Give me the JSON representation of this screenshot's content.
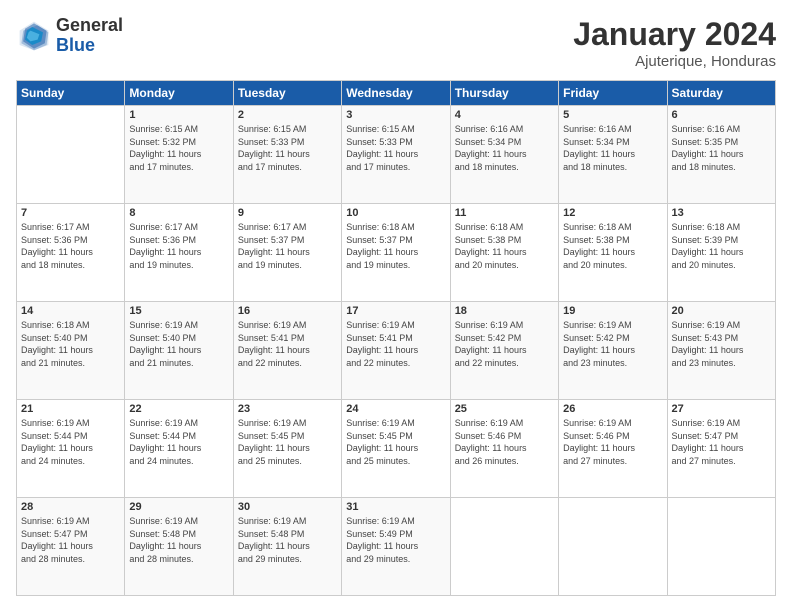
{
  "logo": {
    "general": "General",
    "blue": "Blue"
  },
  "header": {
    "month": "January 2024",
    "location": "Ajuterique, Honduras"
  },
  "days_of_week": [
    "Sunday",
    "Monday",
    "Tuesday",
    "Wednesday",
    "Thursday",
    "Friday",
    "Saturday"
  ],
  "weeks": [
    [
      {
        "day": "",
        "info": ""
      },
      {
        "day": "1",
        "info": "Sunrise: 6:15 AM\nSunset: 5:32 PM\nDaylight: 11 hours\nand 17 minutes."
      },
      {
        "day": "2",
        "info": "Sunrise: 6:15 AM\nSunset: 5:33 PM\nDaylight: 11 hours\nand 17 minutes."
      },
      {
        "day": "3",
        "info": "Sunrise: 6:15 AM\nSunset: 5:33 PM\nDaylight: 11 hours\nand 17 minutes."
      },
      {
        "day": "4",
        "info": "Sunrise: 6:16 AM\nSunset: 5:34 PM\nDaylight: 11 hours\nand 18 minutes."
      },
      {
        "day": "5",
        "info": "Sunrise: 6:16 AM\nSunset: 5:34 PM\nDaylight: 11 hours\nand 18 minutes."
      },
      {
        "day": "6",
        "info": "Sunrise: 6:16 AM\nSunset: 5:35 PM\nDaylight: 11 hours\nand 18 minutes."
      }
    ],
    [
      {
        "day": "7",
        "info": "Sunrise: 6:17 AM\nSunset: 5:36 PM\nDaylight: 11 hours\nand 18 minutes."
      },
      {
        "day": "8",
        "info": "Sunrise: 6:17 AM\nSunset: 5:36 PM\nDaylight: 11 hours\nand 19 minutes."
      },
      {
        "day": "9",
        "info": "Sunrise: 6:17 AM\nSunset: 5:37 PM\nDaylight: 11 hours\nand 19 minutes."
      },
      {
        "day": "10",
        "info": "Sunrise: 6:18 AM\nSunset: 5:37 PM\nDaylight: 11 hours\nand 19 minutes."
      },
      {
        "day": "11",
        "info": "Sunrise: 6:18 AM\nSunset: 5:38 PM\nDaylight: 11 hours\nand 20 minutes."
      },
      {
        "day": "12",
        "info": "Sunrise: 6:18 AM\nSunset: 5:38 PM\nDaylight: 11 hours\nand 20 minutes."
      },
      {
        "day": "13",
        "info": "Sunrise: 6:18 AM\nSunset: 5:39 PM\nDaylight: 11 hours\nand 20 minutes."
      }
    ],
    [
      {
        "day": "14",
        "info": "Sunrise: 6:18 AM\nSunset: 5:40 PM\nDaylight: 11 hours\nand 21 minutes."
      },
      {
        "day": "15",
        "info": "Sunrise: 6:19 AM\nSunset: 5:40 PM\nDaylight: 11 hours\nand 21 minutes."
      },
      {
        "day": "16",
        "info": "Sunrise: 6:19 AM\nSunset: 5:41 PM\nDaylight: 11 hours\nand 22 minutes."
      },
      {
        "day": "17",
        "info": "Sunrise: 6:19 AM\nSunset: 5:41 PM\nDaylight: 11 hours\nand 22 minutes."
      },
      {
        "day": "18",
        "info": "Sunrise: 6:19 AM\nSunset: 5:42 PM\nDaylight: 11 hours\nand 22 minutes."
      },
      {
        "day": "19",
        "info": "Sunrise: 6:19 AM\nSunset: 5:42 PM\nDaylight: 11 hours\nand 23 minutes."
      },
      {
        "day": "20",
        "info": "Sunrise: 6:19 AM\nSunset: 5:43 PM\nDaylight: 11 hours\nand 23 minutes."
      }
    ],
    [
      {
        "day": "21",
        "info": "Sunrise: 6:19 AM\nSunset: 5:44 PM\nDaylight: 11 hours\nand 24 minutes."
      },
      {
        "day": "22",
        "info": "Sunrise: 6:19 AM\nSunset: 5:44 PM\nDaylight: 11 hours\nand 24 minutes."
      },
      {
        "day": "23",
        "info": "Sunrise: 6:19 AM\nSunset: 5:45 PM\nDaylight: 11 hours\nand 25 minutes."
      },
      {
        "day": "24",
        "info": "Sunrise: 6:19 AM\nSunset: 5:45 PM\nDaylight: 11 hours\nand 25 minutes."
      },
      {
        "day": "25",
        "info": "Sunrise: 6:19 AM\nSunset: 5:46 PM\nDaylight: 11 hours\nand 26 minutes."
      },
      {
        "day": "26",
        "info": "Sunrise: 6:19 AM\nSunset: 5:46 PM\nDaylight: 11 hours\nand 27 minutes."
      },
      {
        "day": "27",
        "info": "Sunrise: 6:19 AM\nSunset: 5:47 PM\nDaylight: 11 hours\nand 27 minutes."
      }
    ],
    [
      {
        "day": "28",
        "info": "Sunrise: 6:19 AM\nSunset: 5:47 PM\nDaylight: 11 hours\nand 28 minutes."
      },
      {
        "day": "29",
        "info": "Sunrise: 6:19 AM\nSunset: 5:48 PM\nDaylight: 11 hours\nand 28 minutes."
      },
      {
        "day": "30",
        "info": "Sunrise: 6:19 AM\nSunset: 5:48 PM\nDaylight: 11 hours\nand 29 minutes."
      },
      {
        "day": "31",
        "info": "Sunrise: 6:19 AM\nSunset: 5:49 PM\nDaylight: 11 hours\nand 29 minutes."
      },
      {
        "day": "",
        "info": ""
      },
      {
        "day": "",
        "info": ""
      },
      {
        "day": "",
        "info": ""
      }
    ]
  ]
}
